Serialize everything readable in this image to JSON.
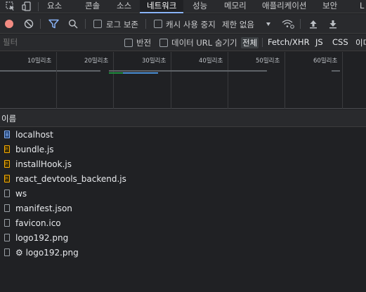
{
  "tabs": [
    {
      "label": "요소",
      "active": false
    },
    {
      "label": "콘솔",
      "active": false
    },
    {
      "label": "소스",
      "active": false
    },
    {
      "label": "네트워크",
      "active": true
    },
    {
      "label": "성능",
      "active": false
    },
    {
      "label": "메모리",
      "active": false
    },
    {
      "label": "애플리케이션",
      "active": false
    },
    {
      "label": "보안",
      "active": false
    },
    {
      "label": "L",
      "active": false
    }
  ],
  "toolbar": {
    "preserve_log_label": "로그 보존",
    "disable_cache_label": "캐시 사용 중지",
    "throttle_value": "제한 없음"
  },
  "filter": {
    "placeholder": "필터",
    "invert_label": "반전",
    "hide_data_urls_label": "데이터 URL 숨기기",
    "types": [
      "전체",
      "Fetch/XHR",
      "JS",
      "CSS",
      "이미"
    ]
  },
  "overview": {
    "ticks": [
      "10밀리초",
      "20밀리초",
      "30밀리초",
      "40밀리초",
      "50밀리초",
      "60밀리초"
    ]
  },
  "columns": {
    "name_header": "이름"
  },
  "requests": [
    {
      "name": "localhost",
      "icon": "document-icon"
    },
    {
      "name": "bundle.js",
      "icon": "script-icon"
    },
    {
      "name": "installHook.js",
      "icon": "script-icon"
    },
    {
      "name": "react_devtools_backend.js",
      "icon": "script-icon"
    },
    {
      "name": "ws",
      "icon": "file-icon"
    },
    {
      "name": "manifest.json",
      "icon": "file-icon"
    },
    {
      "name": "favicon.ico",
      "icon": "file-icon"
    },
    {
      "name": "logo192.png",
      "icon": "file-icon"
    },
    {
      "name": "⚙ logo192.png",
      "icon": "file-icon"
    }
  ],
  "colors": {
    "accent": "#8ab4f8",
    "record": "#f28b82",
    "waterfall_green": "#1e8e3e",
    "waterfall_blue": "#4a8fd6"
  }
}
